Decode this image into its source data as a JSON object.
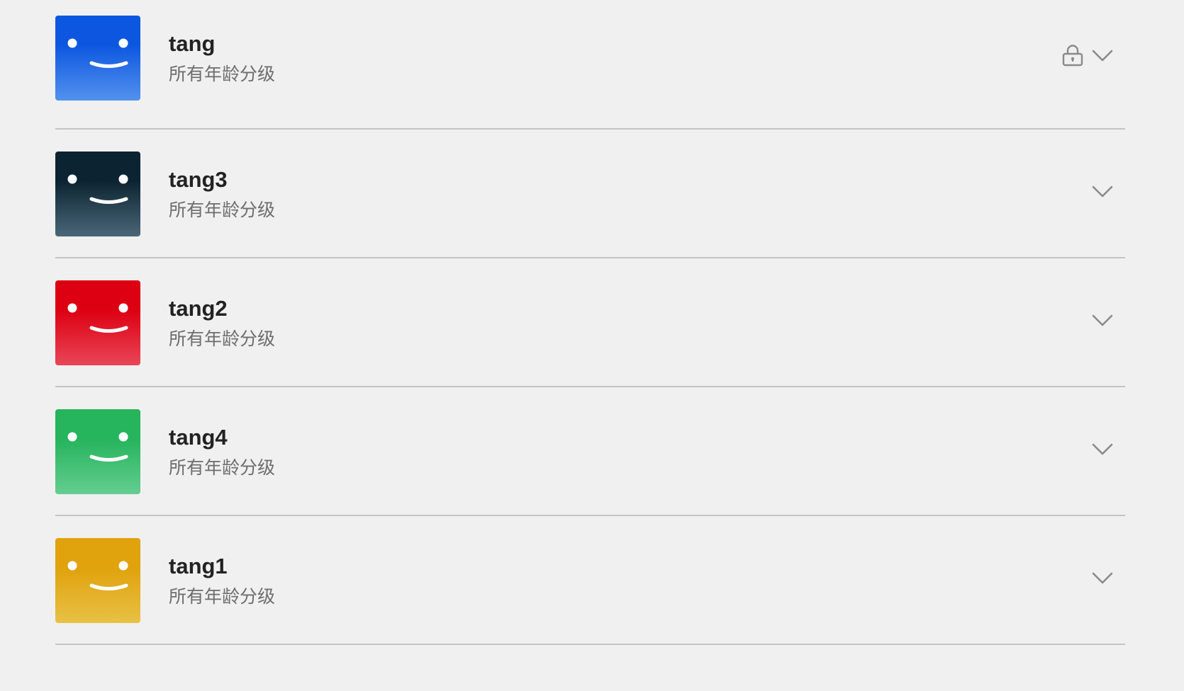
{
  "profiles": [
    {
      "name": "tang",
      "rating": "所有年龄分级",
      "locked": true,
      "colors": {
        "top": "#0d57e0",
        "bottom": "#5391ee"
      }
    },
    {
      "name": "tang3",
      "rating": "所有年龄分级",
      "locked": false,
      "colors": {
        "top": "#0c2432",
        "bottom": "#4a6777"
      }
    },
    {
      "name": "tang2",
      "rating": "所有年龄分级",
      "locked": false,
      "colors": {
        "top": "#dd0013",
        "bottom": "#e84657"
      }
    },
    {
      "name": "tang4",
      "rating": "所有年龄分级",
      "locked": false,
      "colors": {
        "top": "#26b45d",
        "bottom": "#64cd90"
      }
    },
    {
      "name": "tang1",
      "rating": "所有年龄分级",
      "locked": false,
      "colors": {
        "top": "#e0a20d",
        "bottom": "#e8c145"
      }
    }
  ],
  "icons": {
    "lock": "lock-icon",
    "chevron": "chevron-down-icon",
    "avatar_face": "smiley-face-icon"
  }
}
